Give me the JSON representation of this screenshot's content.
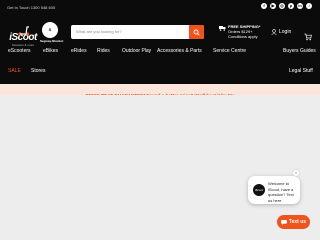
{
  "topbar": {
    "contact_text": "Get In Touch 1300 548 605"
  },
  "socials": [
    {
      "icon": "facebook-icon",
      "glyph": "f"
    },
    {
      "icon": "youtube-icon",
      "glyph": "▶"
    },
    {
      "icon": "instagram-icon",
      "glyph": "◎"
    },
    {
      "icon": "pinterest-icon",
      "glyph": "p"
    },
    {
      "icon": "linkedin-icon",
      "glyph": "in"
    },
    {
      "icon": "tiktok-icon",
      "glyph": "♪"
    }
  ],
  "logo": {
    "word": "iScoot",
    "tagline": "Scooters & more"
  },
  "badge": {
    "label": "Segway-Ninebot"
  },
  "search": {
    "placeholder": "What are you looking for?",
    "icon": "search-icon"
  },
  "shipping": {
    "line1": "FREE SHIPPING*",
    "line2": "Orders $129+",
    "line3": "Conditions apply"
  },
  "account": {
    "login_label": "Login"
  },
  "nav": {
    "items": [
      "eScooters",
      "eBikes",
      "eRides",
      "Rides",
      "Outdoor Play",
      "Accessories & Parts",
      "Service Centre",
      "Buyers Guides"
    ]
  },
  "nav2": {
    "sale": "SALE",
    "stores": "Stores",
    "legal": "Legal Stuff"
  },
  "promo": {
    "text": "PRICE BEAT GUARANTEE* Found a better price? We'll beat it by 5%"
  },
  "chat": {
    "message": "Welcome to iScoot, have a question? Text us here.",
    "avatar": "iScoot"
  },
  "textus": {
    "label": "Text us"
  },
  "colors": {
    "accent": "#f0531c",
    "header_bg": "#0b0b0b",
    "promo_bg": "#fbe4da",
    "page_bg": "#ededed"
  }
}
